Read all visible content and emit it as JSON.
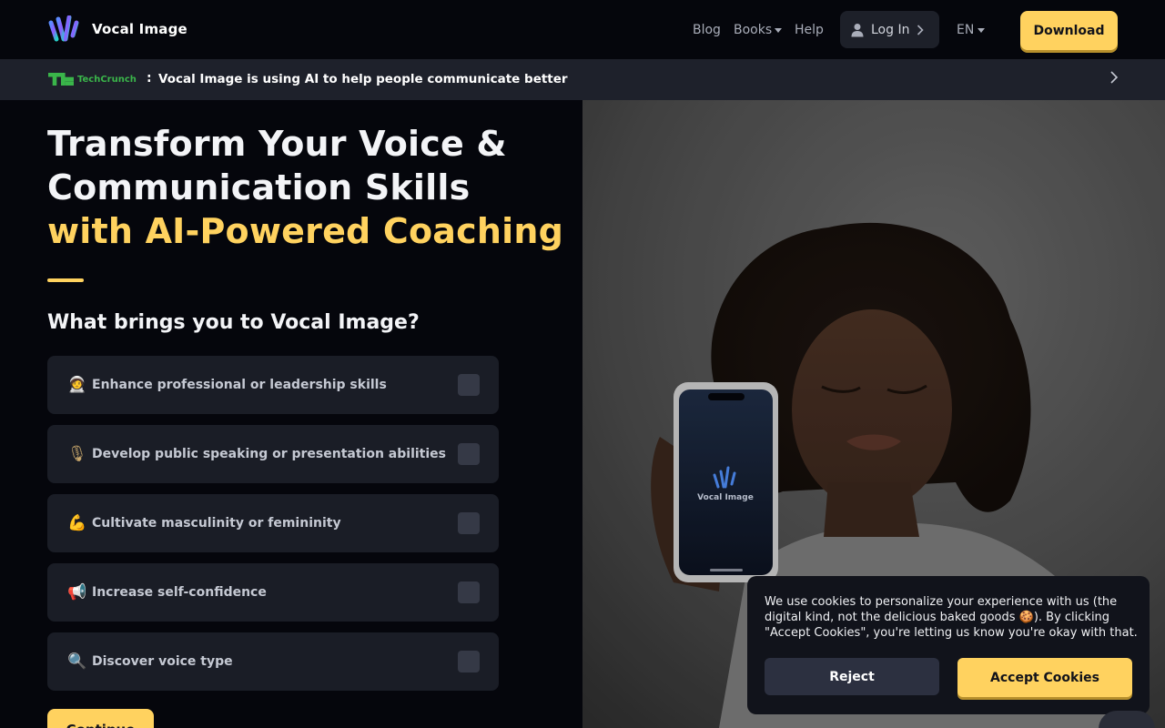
{
  "header": {
    "brand": "Vocal Image",
    "nav": {
      "blog": "Blog",
      "books": "Books",
      "help": "Help"
    },
    "login_label": "Log In",
    "language": "EN",
    "download_label": "Download"
  },
  "news": {
    "source": "TechCrunch",
    "separator": ":",
    "headline": "Vocal Image is using AI to help people communicate better"
  },
  "hero": {
    "title_line1": "Transform Your Voice &",
    "title_line2": "Communication Skills",
    "title_accent": "with AI-Powered Coaching",
    "question": "What brings you to Vocal Image?",
    "options": [
      {
        "emoji": "🧑‍🚀",
        "label": "Enhance professional or leadership skills"
      },
      {
        "emoji": "🎙",
        "label": "Develop public speaking or presentation abilities"
      },
      {
        "emoji": "💪",
        "label": "Cultivate masculinity or femininity"
      },
      {
        "emoji": "📢",
        "label": "Increase self-confidence"
      },
      {
        "emoji": "🔍",
        "label": "Discover voice type"
      }
    ],
    "continue_label": "Continue"
  },
  "phone": {
    "app_name": "Vocal Image"
  },
  "cookie": {
    "text": "We use cookies to personalize your experience with us (the digital kind, not the delicious baked goods 🍪). By clicking \"Accept Cookies\", you're letting us know you're okay with that.",
    "reject_label": "Reject",
    "accept_label": "Accept Cookies"
  },
  "colors": {
    "accent": "#ffd25f",
    "background": "#05060c",
    "card": "#1a1d26",
    "techcrunch_green": "#3ab54a"
  }
}
